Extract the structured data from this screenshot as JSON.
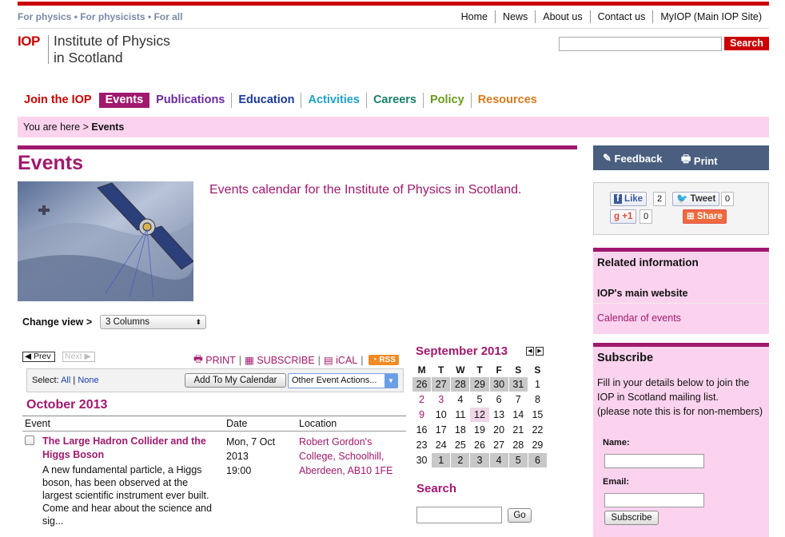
{
  "header": {
    "tagline": "For physics • For physicists • For all",
    "links": [
      "Home",
      "News",
      "About us",
      "Contact us",
      "MyIOP (Main IOP Site)"
    ],
    "logo_mark": "IOP",
    "logo_line1": "Institute of Physics",
    "logo_line2": "in Scotland",
    "search_button": "Search"
  },
  "nav": {
    "items": [
      {
        "label": "Join the IOP",
        "color": "#cc0000"
      },
      {
        "label": "Events",
        "color": "#ffffff"
      },
      {
        "label": "Publications",
        "color": "#6a2a9c"
      },
      {
        "label": "Education",
        "color": "#1a3a9c"
      },
      {
        "label": "Activities",
        "color": "#1fa0c8"
      },
      {
        "label": "Careers",
        "color": "#17806b"
      },
      {
        "label": "Policy",
        "color": "#6a9a1c"
      },
      {
        "label": "Resources",
        "color": "#d97a1e"
      }
    ],
    "active_index": 1
  },
  "breadcrumb": {
    "prefix": "You are here > ",
    "current": "Events"
  },
  "page": {
    "title": "Events",
    "intro": "Events calendar for the Institute of Physics in Scotland."
  },
  "view": {
    "label": "Change view >",
    "selected": "3 Columns"
  },
  "tools": {
    "prev": "Prev",
    "next": "Next",
    "print": "PRINT",
    "subscribe": "SUBSCRIBE",
    "ical": "iCAL",
    "rss": "RSS",
    "select_label": "Select:",
    "select_all": "All",
    "select_none": "None",
    "add_calendar": "Add To My Calendar",
    "other_actions": "Other Event Actions..."
  },
  "listing": {
    "month": "October 2013",
    "columns": [
      "Event",
      "Date",
      "Location"
    ],
    "event": {
      "title": "The Large Hadron Collider and the Higgs Boson",
      "description": "A new fundamental particle, a Higgs boson, has been observed at the largest scientific instrument ever built.  Come and hear about the science and sig...",
      "date_line1": "Mon, 7 Oct",
      "date_line2": "2013",
      "date_line3": "19:00",
      "location": "Robert Gordon's College, Schoolhill, Aberdeen, AB10 1FE"
    }
  },
  "calendar": {
    "title": "September 2013",
    "weekdays": [
      "M",
      "T",
      "W",
      "T",
      "F",
      "S",
      "S"
    ],
    "weeks": [
      [
        {
          "d": "26",
          "o": true
        },
        {
          "d": "27",
          "o": true
        },
        {
          "d": "28",
          "o": true
        },
        {
          "d": "29",
          "o": true
        },
        {
          "d": "30",
          "o": true
        },
        {
          "d": "31",
          "o": true
        },
        {
          "d": "1"
        }
      ],
      [
        {
          "d": "2",
          "l": true
        },
        {
          "d": "3",
          "l": true
        },
        {
          "d": "4"
        },
        {
          "d": "5"
        },
        {
          "d": "6"
        },
        {
          "d": "7"
        },
        {
          "d": "8"
        }
      ],
      [
        {
          "d": "9",
          "l": true
        },
        {
          "d": "10"
        },
        {
          "d": "11"
        },
        {
          "d": "12",
          "t": true
        },
        {
          "d": "13"
        },
        {
          "d": "14"
        },
        {
          "d": "15"
        }
      ],
      [
        {
          "d": "16"
        },
        {
          "d": "17"
        },
        {
          "d": "18"
        },
        {
          "d": "19"
        },
        {
          "d": "20"
        },
        {
          "d": "21"
        },
        {
          "d": "22"
        }
      ],
      [
        {
          "d": "23"
        },
        {
          "d": "24"
        },
        {
          "d": "25"
        },
        {
          "d": "26"
        },
        {
          "d": "27"
        },
        {
          "d": "28"
        },
        {
          "d": "29"
        }
      ],
      [
        {
          "d": "30"
        },
        {
          "d": "1",
          "o": true
        },
        {
          "d": "2",
          "o": true
        },
        {
          "d": "3",
          "o": true
        },
        {
          "d": "4",
          "o": true
        },
        {
          "d": "5",
          "o": true
        },
        {
          "d": "6",
          "o": true
        }
      ]
    ]
  },
  "side_search": {
    "title": "Search",
    "button": "Go"
  },
  "sidebar": {
    "feedback": "Feedback",
    "print": "Print",
    "social": {
      "like": "Like",
      "like_count": "2",
      "tweet": "Tweet",
      "tweet_count": "0",
      "gplus": "+1",
      "gplus_count": "0",
      "share": "Share"
    },
    "related": {
      "title": "Related information",
      "link1": "IOP's main website",
      "link2": "Calendar of events"
    },
    "subscribe": {
      "title": "Subscribe",
      "text": "Fill in your details below to join the IOP in Scotland mailing list.",
      "note": "(please note this is for non-members)",
      "name_label": "Name:",
      "email_label": "Email:",
      "button": "Subscribe"
    }
  }
}
